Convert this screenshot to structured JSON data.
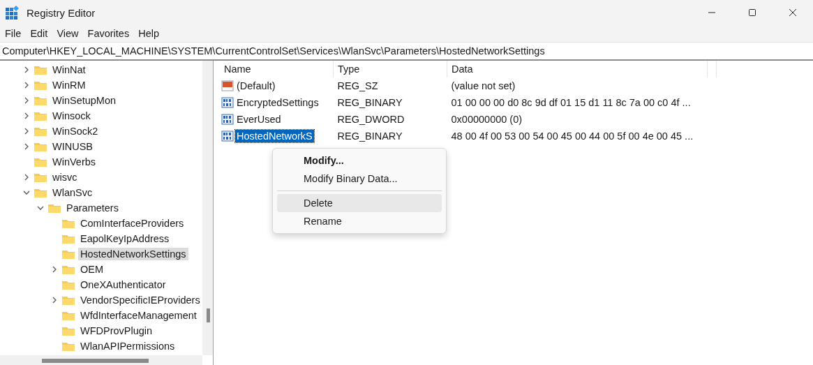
{
  "window": {
    "title": "Registry Editor"
  },
  "menu_bar": [
    "File",
    "Edit",
    "View",
    "Favorites",
    "Help"
  ],
  "address_bar": "Computer\\HKEY_LOCAL_MACHINE\\SYSTEM\\CurrentControlSet\\Services\\WlanSvc\\Parameters\\HostedNetworkSettings",
  "tree": [
    {
      "label": "WinNat",
      "expandable": true,
      "expanded": false,
      "selected": false
    },
    {
      "label": "WinRM",
      "expandable": true,
      "expanded": false,
      "selected": false
    },
    {
      "label": "WinSetupMon",
      "expandable": true,
      "expanded": false,
      "selected": false
    },
    {
      "label": "Winsock",
      "expandable": true,
      "expanded": false,
      "selected": false
    },
    {
      "label": "WinSock2",
      "expandable": true,
      "expanded": false,
      "selected": false
    },
    {
      "label": "WINUSB",
      "expandable": true,
      "expanded": false,
      "selected": false
    },
    {
      "label": "WinVerbs",
      "expandable": false,
      "expanded": false,
      "selected": false
    },
    {
      "label": "wisvc",
      "expandable": true,
      "expanded": false,
      "selected": false
    },
    {
      "label": "WlanSvc",
      "expandable": true,
      "expanded": true,
      "selected": false,
      "children": [
        {
          "label": "Parameters",
          "expandable": true,
          "expanded": true,
          "selected": false,
          "children": [
            {
              "label": "ComInterfaceProviders",
              "expandable": false,
              "expanded": false,
              "selected": false
            },
            {
              "label": "EapolKeyIpAddress",
              "expandable": false,
              "expanded": false,
              "selected": false
            },
            {
              "label": "HostedNetworkSettings",
              "expandable": false,
              "expanded": false,
              "selected": true
            },
            {
              "label": "OEM",
              "expandable": true,
              "expanded": false,
              "selected": false
            },
            {
              "label": "OneXAuthenticator",
              "expandable": false,
              "expanded": false,
              "selected": false
            },
            {
              "label": "VendorSpecificIEProviders",
              "expandable": true,
              "expanded": false,
              "selected": false
            },
            {
              "label": "WfdInterfaceManagement",
              "expandable": false,
              "expanded": false,
              "selected": false
            },
            {
              "label": "WFDProvPlugin",
              "expandable": false,
              "expanded": false,
              "selected": false
            },
            {
              "label": "WlanAPIPermissions",
              "expandable": false,
              "expanded": false,
              "selected": false
            }
          ]
        }
      ]
    }
  ],
  "table": {
    "columns": [
      "Name",
      "Type",
      "Data"
    ],
    "rows": [
      {
        "kind": "string",
        "name": "(Default)",
        "type": "REG_SZ",
        "data": "(value not set)",
        "selected": false
      },
      {
        "kind": "binary",
        "name": "EncryptedSettings",
        "type": "REG_BINARY",
        "data": "01 00 00 00 d0 8c 9d df 01 15 d1 11 8c 7a 00 c0 4f ...",
        "selected": false
      },
      {
        "kind": "binary",
        "name": "EverUsed",
        "type": "REG_DWORD",
        "data": "0x00000000 (0)",
        "selected": false
      },
      {
        "kind": "binary",
        "name": "HostedNetworkS",
        "type": "REG_BINARY",
        "data": "48 00 4f 00 53 00 54 00 45 00 44 00 5f 00 4e 00 45 ...",
        "selected": true
      }
    ]
  },
  "context_menu": [
    {
      "kind": "item",
      "label": "Modify...",
      "default": true,
      "hovered": false
    },
    {
      "kind": "item",
      "label": "Modify Binary Data...",
      "default": false,
      "hovered": false
    },
    {
      "kind": "separator"
    },
    {
      "kind": "item",
      "label": "Delete",
      "default": false,
      "hovered": true
    },
    {
      "kind": "item",
      "label": "Rename",
      "default": false,
      "hovered": false
    }
  ]
}
